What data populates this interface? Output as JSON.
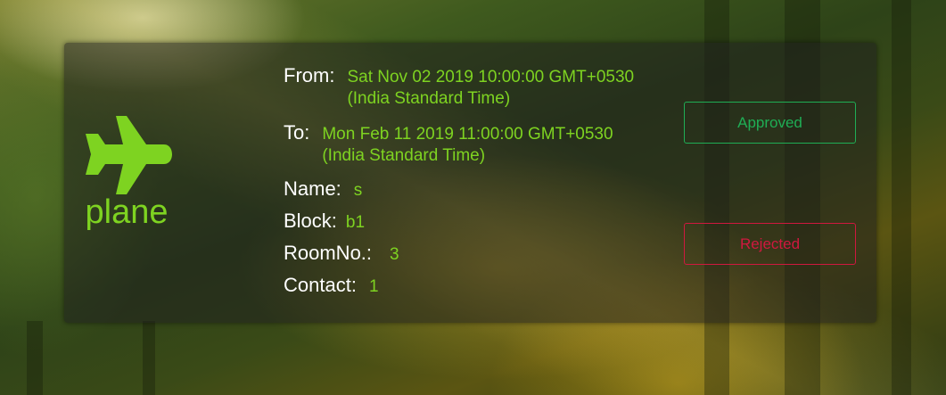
{
  "request": {
    "type_icon": "plane-icon",
    "type_label": "plane",
    "from_label": "From:",
    "from_value": "Sat Nov 02 2019 10:00:00 GMT+0530 (India Standard Time)",
    "to_label": "To:",
    "to_value": "Mon Feb 11 2019 11:00:00 GMT+0530 (India Standard Time)",
    "name_label": "Name:",
    "name_value": "s",
    "block_label": "Block:",
    "block_value": "b1",
    "room_label": "RoomNo.:",
    "room_value": "3",
    "contact_label": "Contact:",
    "contact_value": "1"
  },
  "actions": {
    "approved_label": "Approved",
    "rejected_label": "Rejected"
  },
  "colors": {
    "accent_green": "#7ed321",
    "approved": "#1fae55",
    "rejected": "#d0183f"
  }
}
